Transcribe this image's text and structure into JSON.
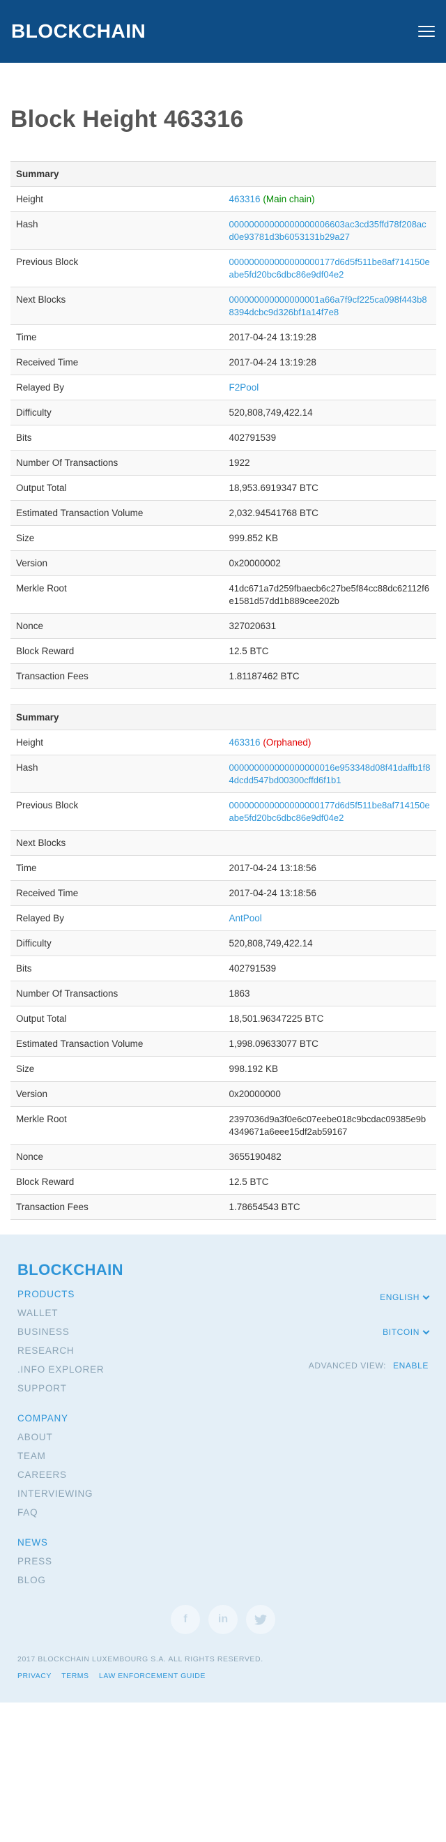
{
  "header": {
    "logo": "BLOCKCHAIN"
  },
  "page": {
    "title": "Block Height 463316"
  },
  "summary_label": "Summary",
  "labels": {
    "height": "Height",
    "hash": "Hash",
    "previous_block": "Previous Block",
    "next_blocks": "Next Blocks",
    "time": "Time",
    "received_time": "Received Time",
    "relayed_by": "Relayed By",
    "difficulty": "Difficulty",
    "bits": "Bits",
    "num_tx": "Number Of Transactions",
    "output_total": "Output Total",
    "est_volume": "Estimated Transaction Volume",
    "size": "Size",
    "version": "Version",
    "merkle_root": "Merkle Root",
    "nonce": "Nonce",
    "block_reward": "Block Reward",
    "tx_fees": "Transaction Fees"
  },
  "blocks": [
    {
      "height": "463316",
      "chain_status": "(Main chain)",
      "hash": "00000000000000000006603ac3cd35ffd78f208acd0e93781d3b6053131b29a27",
      "previous_block": "000000000000000000177d6d5f511be8af714150eabe5fd20bc6dbc86e9df04e2",
      "next_blocks": "000000000000000001a66a7f9cf225ca098f443b88394dcbc9d326bf1a14f7e8",
      "time": "2017-04-24 13:19:28",
      "received_time": "2017-04-24 13:19:28",
      "relayed_by": "F2Pool",
      "difficulty": "520,808,749,422.14",
      "bits": "402791539",
      "num_tx": "1922",
      "output_total": "18,953.6919347 BTC",
      "est_volume": "2,032.94541768 BTC",
      "size": "999.852 KB",
      "version": "0x20000002",
      "merkle_root": "41dc671a7d259fbaecb6c27be5f84cc88dc62112f6e1581d57dd1b889cee202b",
      "nonce": "327020631",
      "block_reward": "12.5 BTC",
      "tx_fees": "1.81187462 BTC"
    },
    {
      "height": "463316",
      "chain_status": "(Orphaned)",
      "hash": "000000000000000000016e953348d08f41daffb1f84dcdd547bd00300cffd6f1b1",
      "previous_block": "000000000000000000177d6d5f511be8af714150eabe5fd20bc6dbc86e9df04e2",
      "next_blocks": "",
      "time": "2017-04-24 13:18:56",
      "received_time": "2017-04-24 13:18:56",
      "relayed_by": "AntPool",
      "difficulty": "520,808,749,422.14",
      "bits": "402791539",
      "num_tx": "1863",
      "output_total": "18,501.96347225 BTC",
      "est_volume": "1,998.09633077 BTC",
      "size": "998.192 KB",
      "version": "0x20000000",
      "merkle_root": "2397036d9a3f0e6c07eebe018c9bcdac09385e9b4349671a6eee15df2ab59167",
      "nonce": "3655190482",
      "block_reward": "12.5 BTC",
      "tx_fees": "1.78654543 BTC"
    }
  ],
  "footer": {
    "logo": "BLOCKCHAIN",
    "products": {
      "head": "PRODUCTS",
      "items": [
        "WALLET",
        "BUSINESS",
        "RESEARCH",
        ".INFO EXPLORER",
        "SUPPORT"
      ]
    },
    "company": {
      "head": "COMPANY",
      "items": [
        "ABOUT",
        "TEAM",
        "CAREERS",
        "INTERVIEWING",
        "FAQ"
      ]
    },
    "news": {
      "head": "NEWS",
      "items": [
        "PRESS",
        "BLOG"
      ]
    },
    "language": "ENGLISH",
    "currency": "BITCOIN",
    "advanced_view_label": "ADVANCED VIEW:",
    "advanced_view_value": "ENABLE",
    "social": {
      "facebook": "f",
      "linkedin": "in",
      "twitter": "t"
    },
    "copyright": "2017 BLOCKCHAIN LUXEMBOURG S.A. ALL RIGHTS RESERVED.",
    "legal": [
      "PRIVACY",
      "TERMS",
      "LAW ENFORCEMENT GUIDE"
    ]
  },
  "colors": {
    "header_bg": "#0e4d86",
    "link": "#2e95d8",
    "main_chain": "#008a00",
    "orphaned": "#e30000",
    "footer_bg": "#e4eff7"
  }
}
